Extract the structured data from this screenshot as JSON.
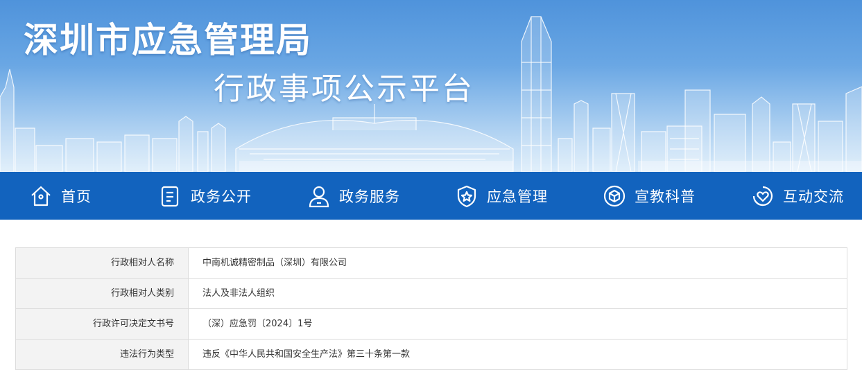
{
  "header": {
    "org_title": "深圳市应急管理局",
    "platform_title": "行政事项公示平台"
  },
  "nav": [
    {
      "label": "首页",
      "icon": "home-icon"
    },
    {
      "label": "政务公开",
      "icon": "document-icon"
    },
    {
      "label": "政务服务",
      "icon": "user-icon"
    },
    {
      "label": "应急管理",
      "icon": "shield-star-icon"
    },
    {
      "label": "宣教科普",
      "icon": "cube-icon"
    },
    {
      "label": "互动交流",
      "icon": "heart-chat-icon"
    }
  ],
  "details": [
    {
      "key": "行政相对人名称",
      "value": "中南机诚精密制品（深圳）有限公司"
    },
    {
      "key": "行政相对人类别",
      "value": "法人及非法人组织"
    },
    {
      "key": "行政许可决定文书号",
      "value": "（深）应急罚〔2024〕1号"
    },
    {
      "key": "违法行为类型",
      "value": "违反《中华人民共和国安全生产法》第三十条第一款"
    }
  ],
  "colors": {
    "nav_bg": "#1263be",
    "banner_top": "#4f93db",
    "banner_bottom": "#d9ebfa",
    "label_bg": "#f3f3f3",
    "border": "#dcdcdc"
  }
}
